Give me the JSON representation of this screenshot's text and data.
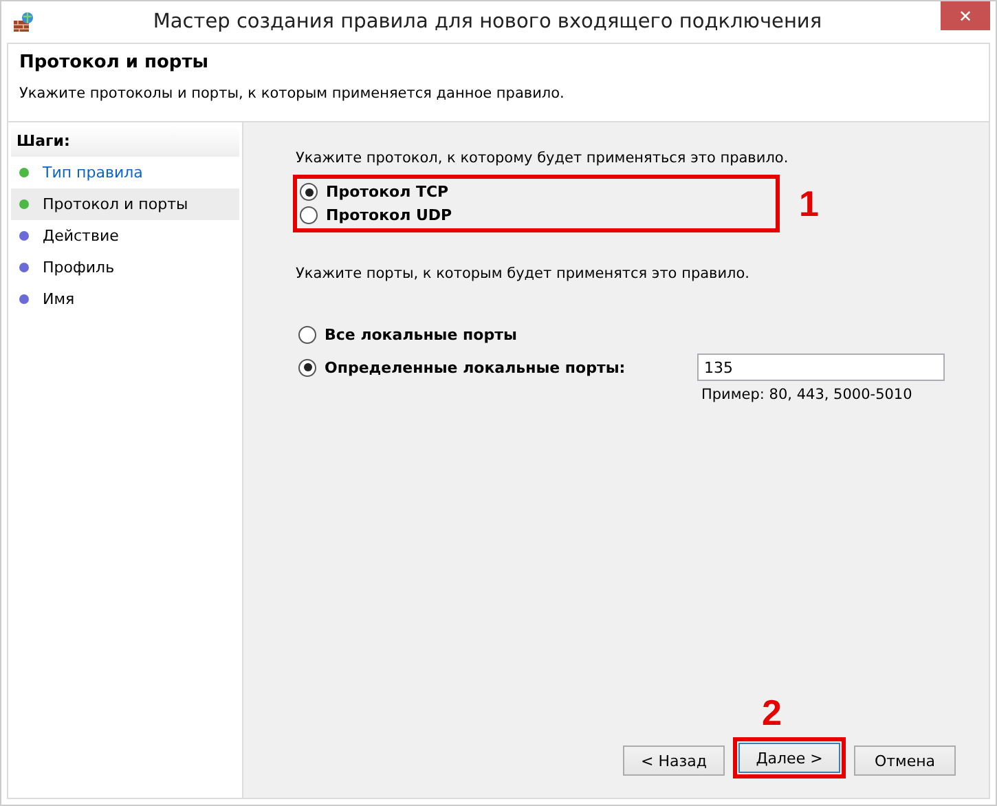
{
  "window": {
    "title": "Мастер создания правила для нового входящего подключения",
    "close": "✕"
  },
  "header": {
    "title": "Протокол и порты",
    "description": "Укажите протоколы и порты, к которым применяется данное правило."
  },
  "sidebar": {
    "title": "Шаги:",
    "items": [
      {
        "label": "Тип правила",
        "color": "#4cb944",
        "selected": false,
        "link": true
      },
      {
        "label": "Протокол и порты",
        "color": "#4cb944",
        "selected": true,
        "link": false
      },
      {
        "label": "Действие",
        "color": "#6a6ad8",
        "selected": false,
        "link": false
      },
      {
        "label": "Профиль",
        "color": "#6a6ad8",
        "selected": false,
        "link": false
      },
      {
        "label": "Имя",
        "color": "#6a6ad8",
        "selected": false,
        "link": false
      }
    ]
  },
  "protocol": {
    "prompt": "Укажите протокол, к которому будет применяться это правило.",
    "annotation": "1",
    "options": [
      {
        "label": "Протокол TCP",
        "selected": true
      },
      {
        "label": "Протокол UDP",
        "selected": false
      }
    ]
  },
  "ports": {
    "prompt": "Укажите порты, к которым будет применятся это правило.",
    "options": [
      {
        "label": "Все локальные порты",
        "selected": false
      },
      {
        "label": "Определенные локальные порты:",
        "selected": true
      }
    ],
    "value": "135",
    "hint": "Пример: 80, 443, 5000-5010"
  },
  "buttons": {
    "annotation": "2",
    "back": "< Назад",
    "next": "Далее >",
    "cancel": "Отмена"
  }
}
